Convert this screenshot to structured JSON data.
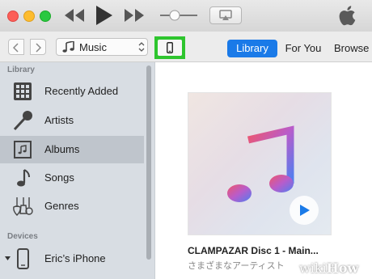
{
  "toolbar": {
    "media_kind": "Music"
  },
  "tabs": [
    {
      "label": "Library",
      "active": true
    },
    {
      "label": "For You",
      "active": false
    },
    {
      "label": "Browse",
      "active": false
    }
  ],
  "sidebar": {
    "library_title": "Library",
    "items": [
      {
        "label": "Recently Added",
        "icon": "grid-icon"
      },
      {
        "label": "Artists",
        "icon": "microphone-icon"
      },
      {
        "label": "Albums",
        "icon": "album-icon",
        "selected": true
      },
      {
        "label": "Songs",
        "icon": "music-note-icon"
      },
      {
        "label": "Genres",
        "icon": "guitar-icon"
      }
    ],
    "devices_title": "Devices",
    "device": {
      "label": "Eric’s iPhone",
      "icon": "iphone-icon"
    }
  },
  "album": {
    "title": "CLAMPAZAR Disc 1 - Main...",
    "artist": "さまざまなアーティスト"
  },
  "watermark": {
    "part1": "wiki",
    "part2": "How"
  },
  "colors": {
    "accent": "#1a7ae8",
    "highlight": "#2ec52e",
    "sidebar_bg": "#d8dde3"
  }
}
